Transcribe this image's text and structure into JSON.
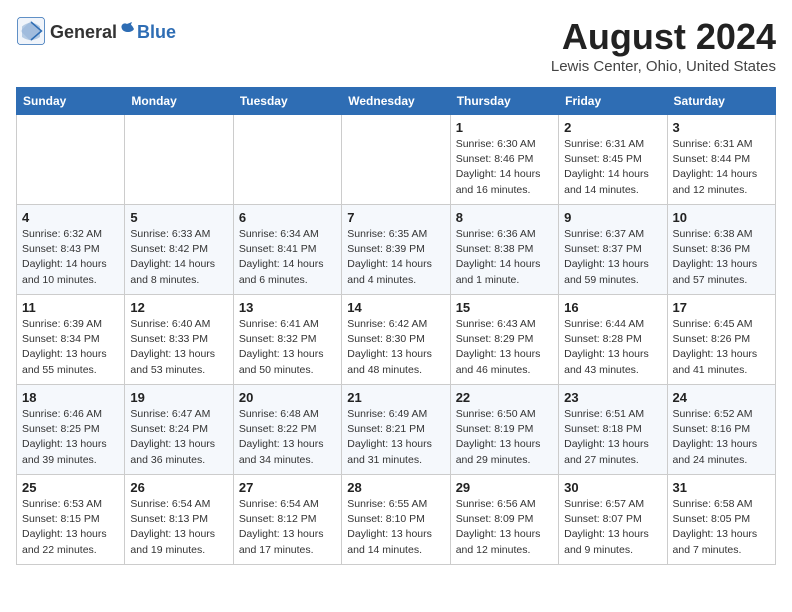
{
  "header": {
    "logo_general": "General",
    "logo_blue": "Blue",
    "month_year": "August 2024",
    "location": "Lewis Center, Ohio, United States"
  },
  "weekdays": [
    "Sunday",
    "Monday",
    "Tuesday",
    "Wednesday",
    "Thursday",
    "Friday",
    "Saturday"
  ],
  "weeks": [
    [
      {
        "day": "",
        "info": ""
      },
      {
        "day": "",
        "info": ""
      },
      {
        "day": "",
        "info": ""
      },
      {
        "day": "",
        "info": ""
      },
      {
        "day": "1",
        "info": "Sunrise: 6:30 AM\nSunset: 8:46 PM\nDaylight: 14 hours\nand 16 minutes."
      },
      {
        "day": "2",
        "info": "Sunrise: 6:31 AM\nSunset: 8:45 PM\nDaylight: 14 hours\nand 14 minutes."
      },
      {
        "day": "3",
        "info": "Sunrise: 6:31 AM\nSunset: 8:44 PM\nDaylight: 14 hours\nand 12 minutes."
      }
    ],
    [
      {
        "day": "4",
        "info": "Sunrise: 6:32 AM\nSunset: 8:43 PM\nDaylight: 14 hours\nand 10 minutes."
      },
      {
        "day": "5",
        "info": "Sunrise: 6:33 AM\nSunset: 8:42 PM\nDaylight: 14 hours\nand 8 minutes."
      },
      {
        "day": "6",
        "info": "Sunrise: 6:34 AM\nSunset: 8:41 PM\nDaylight: 14 hours\nand 6 minutes."
      },
      {
        "day": "7",
        "info": "Sunrise: 6:35 AM\nSunset: 8:39 PM\nDaylight: 14 hours\nand 4 minutes."
      },
      {
        "day": "8",
        "info": "Sunrise: 6:36 AM\nSunset: 8:38 PM\nDaylight: 14 hours\nand 1 minute."
      },
      {
        "day": "9",
        "info": "Sunrise: 6:37 AM\nSunset: 8:37 PM\nDaylight: 13 hours\nand 59 minutes."
      },
      {
        "day": "10",
        "info": "Sunrise: 6:38 AM\nSunset: 8:36 PM\nDaylight: 13 hours\nand 57 minutes."
      }
    ],
    [
      {
        "day": "11",
        "info": "Sunrise: 6:39 AM\nSunset: 8:34 PM\nDaylight: 13 hours\nand 55 minutes."
      },
      {
        "day": "12",
        "info": "Sunrise: 6:40 AM\nSunset: 8:33 PM\nDaylight: 13 hours\nand 53 minutes."
      },
      {
        "day": "13",
        "info": "Sunrise: 6:41 AM\nSunset: 8:32 PM\nDaylight: 13 hours\nand 50 minutes."
      },
      {
        "day": "14",
        "info": "Sunrise: 6:42 AM\nSunset: 8:30 PM\nDaylight: 13 hours\nand 48 minutes."
      },
      {
        "day": "15",
        "info": "Sunrise: 6:43 AM\nSunset: 8:29 PM\nDaylight: 13 hours\nand 46 minutes."
      },
      {
        "day": "16",
        "info": "Sunrise: 6:44 AM\nSunset: 8:28 PM\nDaylight: 13 hours\nand 43 minutes."
      },
      {
        "day": "17",
        "info": "Sunrise: 6:45 AM\nSunset: 8:26 PM\nDaylight: 13 hours\nand 41 minutes."
      }
    ],
    [
      {
        "day": "18",
        "info": "Sunrise: 6:46 AM\nSunset: 8:25 PM\nDaylight: 13 hours\nand 39 minutes."
      },
      {
        "day": "19",
        "info": "Sunrise: 6:47 AM\nSunset: 8:24 PM\nDaylight: 13 hours\nand 36 minutes."
      },
      {
        "day": "20",
        "info": "Sunrise: 6:48 AM\nSunset: 8:22 PM\nDaylight: 13 hours\nand 34 minutes."
      },
      {
        "day": "21",
        "info": "Sunrise: 6:49 AM\nSunset: 8:21 PM\nDaylight: 13 hours\nand 31 minutes."
      },
      {
        "day": "22",
        "info": "Sunrise: 6:50 AM\nSunset: 8:19 PM\nDaylight: 13 hours\nand 29 minutes."
      },
      {
        "day": "23",
        "info": "Sunrise: 6:51 AM\nSunset: 8:18 PM\nDaylight: 13 hours\nand 27 minutes."
      },
      {
        "day": "24",
        "info": "Sunrise: 6:52 AM\nSunset: 8:16 PM\nDaylight: 13 hours\nand 24 minutes."
      }
    ],
    [
      {
        "day": "25",
        "info": "Sunrise: 6:53 AM\nSunset: 8:15 PM\nDaylight: 13 hours\nand 22 minutes."
      },
      {
        "day": "26",
        "info": "Sunrise: 6:54 AM\nSunset: 8:13 PM\nDaylight: 13 hours\nand 19 minutes."
      },
      {
        "day": "27",
        "info": "Sunrise: 6:54 AM\nSunset: 8:12 PM\nDaylight: 13 hours\nand 17 minutes."
      },
      {
        "day": "28",
        "info": "Sunrise: 6:55 AM\nSunset: 8:10 PM\nDaylight: 13 hours\nand 14 minutes."
      },
      {
        "day": "29",
        "info": "Sunrise: 6:56 AM\nSunset: 8:09 PM\nDaylight: 13 hours\nand 12 minutes."
      },
      {
        "day": "30",
        "info": "Sunrise: 6:57 AM\nSunset: 8:07 PM\nDaylight: 13 hours\nand 9 minutes."
      },
      {
        "day": "31",
        "info": "Sunrise: 6:58 AM\nSunset: 8:05 PM\nDaylight: 13 hours\nand 7 minutes."
      }
    ]
  ]
}
